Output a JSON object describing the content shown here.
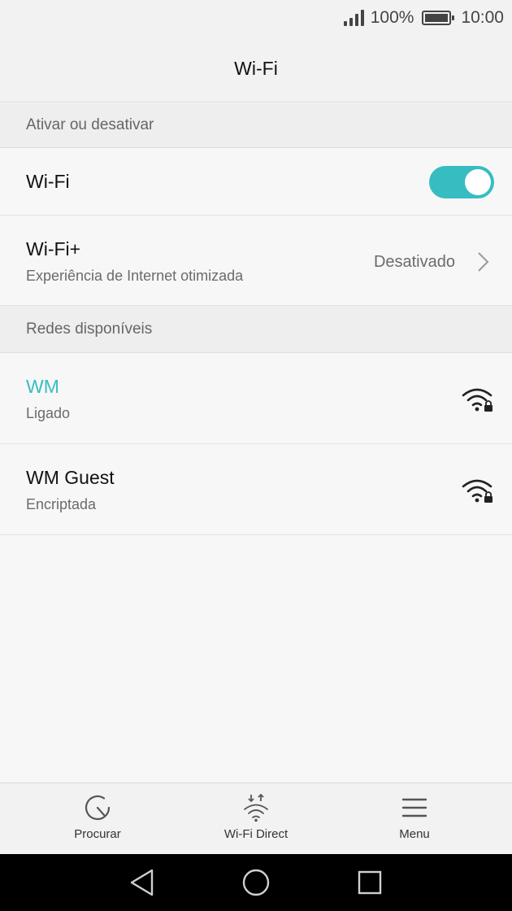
{
  "status_bar": {
    "battery_percent": "100%",
    "time": "10:00",
    "icons": [
      "signal-icon",
      "battery-icon"
    ]
  },
  "header": {
    "title": "Wi-Fi"
  },
  "sections": {
    "toggle_header": "Ativar ou desativar",
    "networks_header": "Redes disponíveis"
  },
  "wifi_toggle": {
    "label": "Wi-Fi",
    "state": "on",
    "accent": "#37bdc1"
  },
  "wifi_plus": {
    "label": "Wi-Fi+",
    "subtitle": "Experiência de Internet otimizada",
    "value": "Desativado"
  },
  "networks": [
    {
      "name": "WM",
      "status": "Ligado",
      "connected": true,
      "color": "#37bdc1",
      "icon": "wifi-locked-icon"
    },
    {
      "name": "WM Guest",
      "status": "Encriptada",
      "connected": false,
      "color": "#111111",
      "icon": "wifi-locked-icon"
    }
  ],
  "bottom_bar": {
    "items": [
      {
        "label": "Procurar",
        "icon": "refresh-scan-icon"
      },
      {
        "label": "Wi-Fi Direct",
        "icon": "wifi-direct-icon"
      },
      {
        "label": "Menu",
        "icon": "menu-icon"
      }
    ]
  },
  "nav_bar": {
    "icons": [
      "back-icon",
      "home-icon",
      "recents-icon"
    ]
  }
}
